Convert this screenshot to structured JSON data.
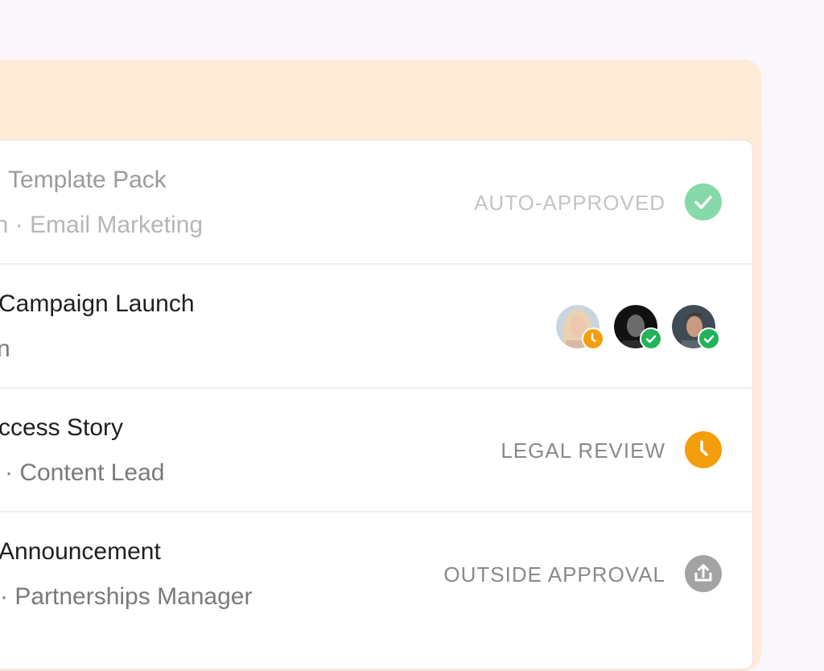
{
  "rows": [
    {
      "title": "Template Pack",
      "subtitle": "son · Email Marketing",
      "status": "AUTO-APPROVED",
      "status_icon": "check-circle-icon",
      "status_color": "#86d9a8"
    },
    {
      "title": "Campaign Launch",
      "subtitle": "n",
      "approvers": [
        {
          "name": "approver-1",
          "state": "pending",
          "badge_color": "#f59e0b"
        },
        {
          "name": "approver-2",
          "state": "approved",
          "badge_color": "#22b35a"
        },
        {
          "name": "approver-3",
          "state": "approved",
          "badge_color": "#22b35a"
        }
      ]
    },
    {
      "title": "ccess Story",
      "subtitle": "· Content Lead",
      "status": "LEGAL REVIEW",
      "status_icon": "clock-icon",
      "status_color": "#f59e0b"
    },
    {
      "title": "Announcement",
      "subtitle": "· Partnerships Manager",
      "status": "OUTSIDE APPROVAL",
      "status_icon": "share-upload-icon",
      "status_color": "#a3a3a3"
    }
  ]
}
